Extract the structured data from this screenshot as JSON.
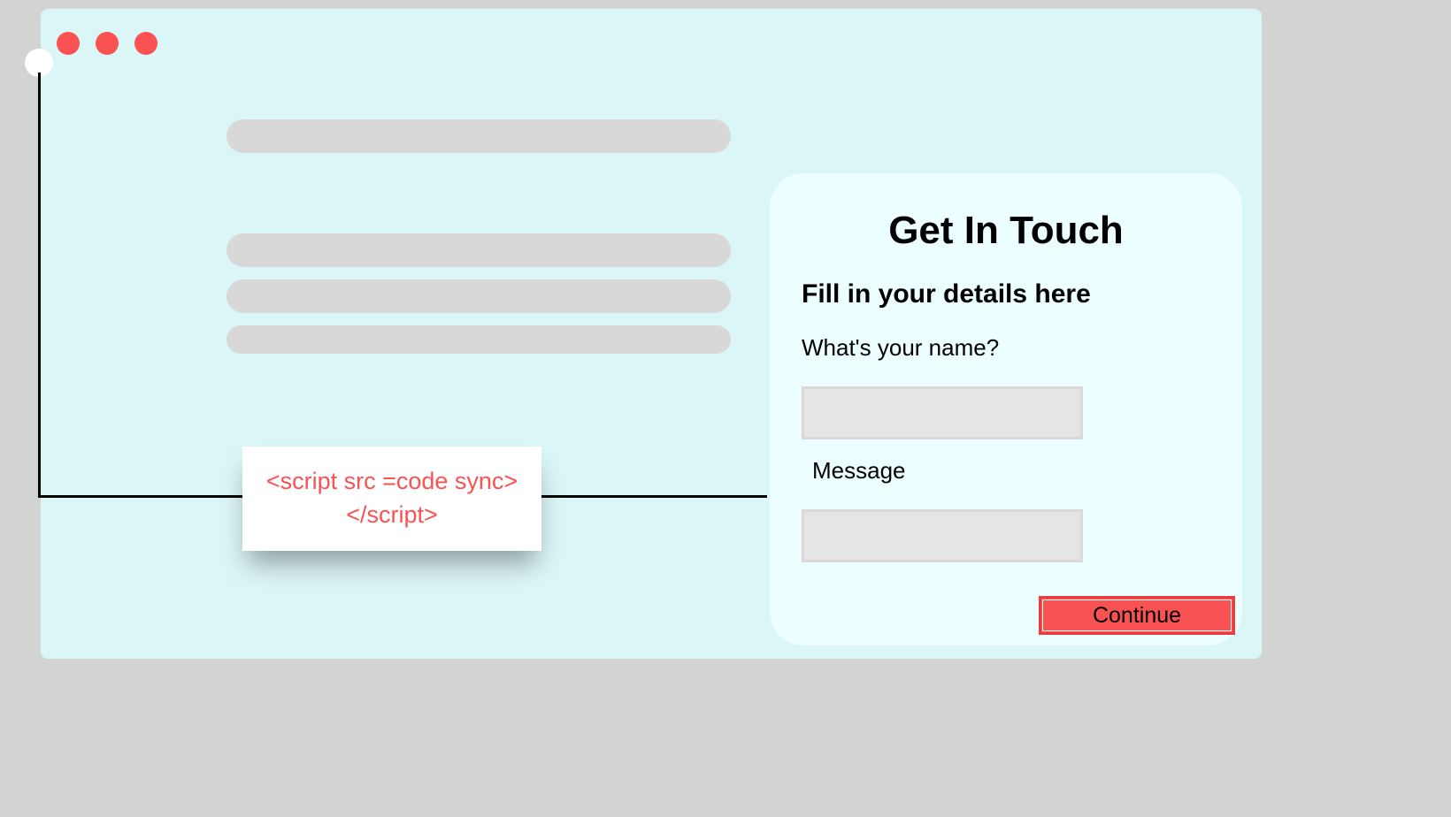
{
  "code_snippet": {
    "line1": "<script src =code sync>",
    "line2": "</script>"
  },
  "form": {
    "title": "Get In Touch",
    "subtitle": "Fill in your details here",
    "name_label": "What's your name?",
    "message_label": "Message",
    "continue_label": "Continue"
  },
  "colors": {
    "accent": "#fa5252",
    "window_bg": "#dbf6f7",
    "panel_bg": "#ecfeff",
    "placeholder": "#d8d8d8"
  }
}
